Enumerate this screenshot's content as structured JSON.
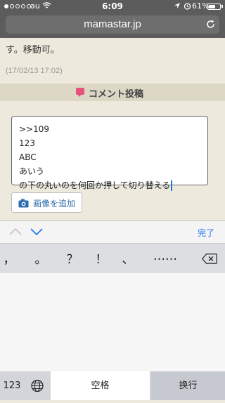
{
  "status_bar": {
    "carrier": "au",
    "time": "6:09",
    "battery_percent": "61%",
    "battery_level": 0.61,
    "signal_dots_filled": 1
  },
  "browser": {
    "url": "mamastar.jp",
    "reload_icon": "reload-icon"
  },
  "page": {
    "text_fragment": "す。移動可。",
    "timestamp": "(17/02/13 17:02)",
    "section_title": "コメント投稿",
    "comment_lines": [
      ">>109",
      "123",
      "ABC",
      "あいう",
      "の下の丸いのを何回か押して切り替える"
    ],
    "add_image_label": "画像を追加"
  },
  "accessory_bar": {
    "done_label": "完了"
  },
  "keyboard": {
    "symbols": [
      "，",
      "。",
      "？",
      "！",
      "、",
      "……"
    ],
    "numbers_key": "123",
    "space_label": "空格",
    "return_label": "换行"
  },
  "colors": {
    "accent": "#1a73e8",
    "comment_icon": "#e8517a",
    "link": "#2b6aad"
  }
}
